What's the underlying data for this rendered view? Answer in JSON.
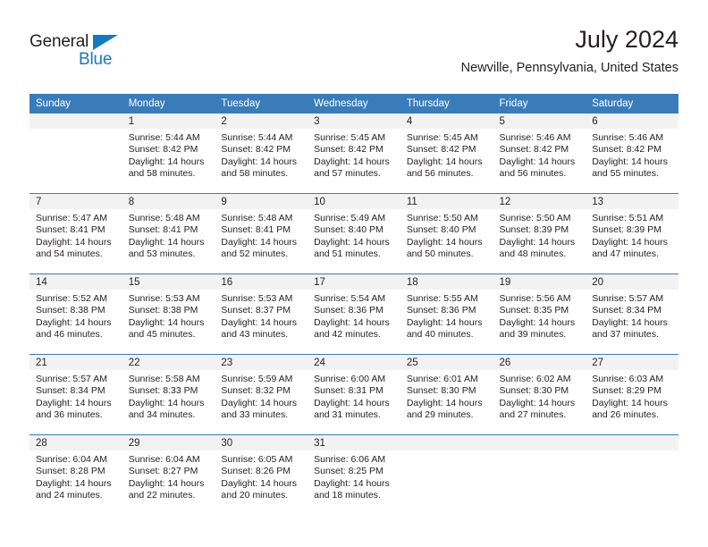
{
  "brand": {
    "name_part1": "General",
    "name_part2": "Blue",
    "flag_icon": "triangle-flag-icon",
    "colors": {
      "blue": "#1878be",
      "dark": "#231f20"
    }
  },
  "header": {
    "title": "July 2024",
    "subtitle": "Newville, Pennsylvania, United States"
  },
  "calendar": {
    "accent_color": "#3a7cba",
    "daynum_band_color": "#f2f2f2",
    "weekday_headers": [
      "Sunday",
      "Monday",
      "Tuesday",
      "Wednesday",
      "Thursday",
      "Friday",
      "Saturday"
    ],
    "weeks": [
      [
        {
          "day": "",
          "sunrise": "",
          "sunset": "",
          "daylight": ""
        },
        {
          "day": "1",
          "sunrise": "Sunrise: 5:44 AM",
          "sunset": "Sunset: 8:42 PM",
          "daylight": "Daylight: 14 hours and 58 minutes."
        },
        {
          "day": "2",
          "sunrise": "Sunrise: 5:44 AM",
          "sunset": "Sunset: 8:42 PM",
          "daylight": "Daylight: 14 hours and 58 minutes."
        },
        {
          "day": "3",
          "sunrise": "Sunrise: 5:45 AM",
          "sunset": "Sunset: 8:42 PM",
          "daylight": "Daylight: 14 hours and 57 minutes."
        },
        {
          "day": "4",
          "sunrise": "Sunrise: 5:45 AM",
          "sunset": "Sunset: 8:42 PM",
          "daylight": "Daylight: 14 hours and 56 minutes."
        },
        {
          "day": "5",
          "sunrise": "Sunrise: 5:46 AM",
          "sunset": "Sunset: 8:42 PM",
          "daylight": "Daylight: 14 hours and 56 minutes."
        },
        {
          "day": "6",
          "sunrise": "Sunrise: 5:46 AM",
          "sunset": "Sunset: 8:42 PM",
          "daylight": "Daylight: 14 hours and 55 minutes."
        }
      ],
      [
        {
          "day": "7",
          "sunrise": "Sunrise: 5:47 AM",
          "sunset": "Sunset: 8:41 PM",
          "daylight": "Daylight: 14 hours and 54 minutes."
        },
        {
          "day": "8",
          "sunrise": "Sunrise: 5:48 AM",
          "sunset": "Sunset: 8:41 PM",
          "daylight": "Daylight: 14 hours and 53 minutes."
        },
        {
          "day": "9",
          "sunrise": "Sunrise: 5:48 AM",
          "sunset": "Sunset: 8:41 PM",
          "daylight": "Daylight: 14 hours and 52 minutes."
        },
        {
          "day": "10",
          "sunrise": "Sunrise: 5:49 AM",
          "sunset": "Sunset: 8:40 PM",
          "daylight": "Daylight: 14 hours and 51 minutes."
        },
        {
          "day": "11",
          "sunrise": "Sunrise: 5:50 AM",
          "sunset": "Sunset: 8:40 PM",
          "daylight": "Daylight: 14 hours and 50 minutes."
        },
        {
          "day": "12",
          "sunrise": "Sunrise: 5:50 AM",
          "sunset": "Sunset: 8:39 PM",
          "daylight": "Daylight: 14 hours and 48 minutes."
        },
        {
          "day": "13",
          "sunrise": "Sunrise: 5:51 AM",
          "sunset": "Sunset: 8:39 PM",
          "daylight": "Daylight: 14 hours and 47 minutes."
        }
      ],
      [
        {
          "day": "14",
          "sunrise": "Sunrise: 5:52 AM",
          "sunset": "Sunset: 8:38 PM",
          "daylight": "Daylight: 14 hours and 46 minutes."
        },
        {
          "day": "15",
          "sunrise": "Sunrise: 5:53 AM",
          "sunset": "Sunset: 8:38 PM",
          "daylight": "Daylight: 14 hours and 45 minutes."
        },
        {
          "day": "16",
          "sunrise": "Sunrise: 5:53 AM",
          "sunset": "Sunset: 8:37 PM",
          "daylight": "Daylight: 14 hours and 43 minutes."
        },
        {
          "day": "17",
          "sunrise": "Sunrise: 5:54 AM",
          "sunset": "Sunset: 8:36 PM",
          "daylight": "Daylight: 14 hours and 42 minutes."
        },
        {
          "day": "18",
          "sunrise": "Sunrise: 5:55 AM",
          "sunset": "Sunset: 8:36 PM",
          "daylight": "Daylight: 14 hours and 40 minutes."
        },
        {
          "day": "19",
          "sunrise": "Sunrise: 5:56 AM",
          "sunset": "Sunset: 8:35 PM",
          "daylight": "Daylight: 14 hours and 39 minutes."
        },
        {
          "day": "20",
          "sunrise": "Sunrise: 5:57 AM",
          "sunset": "Sunset: 8:34 PM",
          "daylight": "Daylight: 14 hours and 37 minutes."
        }
      ],
      [
        {
          "day": "21",
          "sunrise": "Sunrise: 5:57 AM",
          "sunset": "Sunset: 8:34 PM",
          "daylight": "Daylight: 14 hours and 36 minutes."
        },
        {
          "day": "22",
          "sunrise": "Sunrise: 5:58 AM",
          "sunset": "Sunset: 8:33 PM",
          "daylight": "Daylight: 14 hours and 34 minutes."
        },
        {
          "day": "23",
          "sunrise": "Sunrise: 5:59 AM",
          "sunset": "Sunset: 8:32 PM",
          "daylight": "Daylight: 14 hours and 33 minutes."
        },
        {
          "day": "24",
          "sunrise": "Sunrise: 6:00 AM",
          "sunset": "Sunset: 8:31 PM",
          "daylight": "Daylight: 14 hours and 31 minutes."
        },
        {
          "day": "25",
          "sunrise": "Sunrise: 6:01 AM",
          "sunset": "Sunset: 8:30 PM",
          "daylight": "Daylight: 14 hours and 29 minutes."
        },
        {
          "day": "26",
          "sunrise": "Sunrise: 6:02 AM",
          "sunset": "Sunset: 8:30 PM",
          "daylight": "Daylight: 14 hours and 27 minutes."
        },
        {
          "day": "27",
          "sunrise": "Sunrise: 6:03 AM",
          "sunset": "Sunset: 8:29 PM",
          "daylight": "Daylight: 14 hours and 26 minutes."
        }
      ],
      [
        {
          "day": "28",
          "sunrise": "Sunrise: 6:04 AM",
          "sunset": "Sunset: 8:28 PM",
          "daylight": "Daylight: 14 hours and 24 minutes."
        },
        {
          "day": "29",
          "sunrise": "Sunrise: 6:04 AM",
          "sunset": "Sunset: 8:27 PM",
          "daylight": "Daylight: 14 hours and 22 minutes."
        },
        {
          "day": "30",
          "sunrise": "Sunrise: 6:05 AM",
          "sunset": "Sunset: 8:26 PM",
          "daylight": "Daylight: 14 hours and 20 minutes."
        },
        {
          "day": "31",
          "sunrise": "Sunrise: 6:06 AM",
          "sunset": "Sunset: 8:25 PM",
          "daylight": "Daylight: 14 hours and 18 minutes."
        },
        {
          "day": "",
          "sunrise": "",
          "sunset": "",
          "daylight": ""
        },
        {
          "day": "",
          "sunrise": "",
          "sunset": "",
          "daylight": ""
        },
        {
          "day": "",
          "sunrise": "",
          "sunset": "",
          "daylight": ""
        }
      ]
    ]
  }
}
